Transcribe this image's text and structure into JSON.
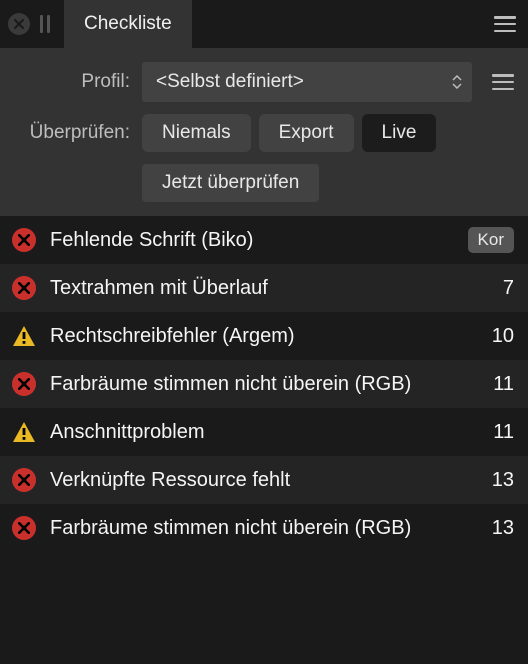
{
  "tab": {
    "title": "Checkliste"
  },
  "profile": {
    "label": "Profil:",
    "value": "<Selbst definiert>"
  },
  "check": {
    "label": "Überprüfen:",
    "options": {
      "never": "Niemals",
      "export": "Export",
      "live": "Live"
    },
    "active": "live",
    "now": "Jetzt überprüfen"
  },
  "items": [
    {
      "type": "error",
      "text": "Fehlende Schrift (Biko)",
      "badge": "Kor"
    },
    {
      "type": "error",
      "text": "Textrahmen mit Überlauf",
      "count": "7"
    },
    {
      "type": "warn",
      "text": "Rechtschreibfehler (Argem)",
      "count": "10"
    },
    {
      "type": "error",
      "text": "Farbräume stimmen nicht überein (RGB)",
      "count": "11"
    },
    {
      "type": "warn",
      "text": "Anschnittproblem",
      "count": "11"
    },
    {
      "type": "error",
      "text": "Verknüpfte Ressource fehlt",
      "count": "13"
    },
    {
      "type": "error",
      "text": "Farbräume stimmen nicht überein (RGB)",
      "count": "13"
    }
  ]
}
